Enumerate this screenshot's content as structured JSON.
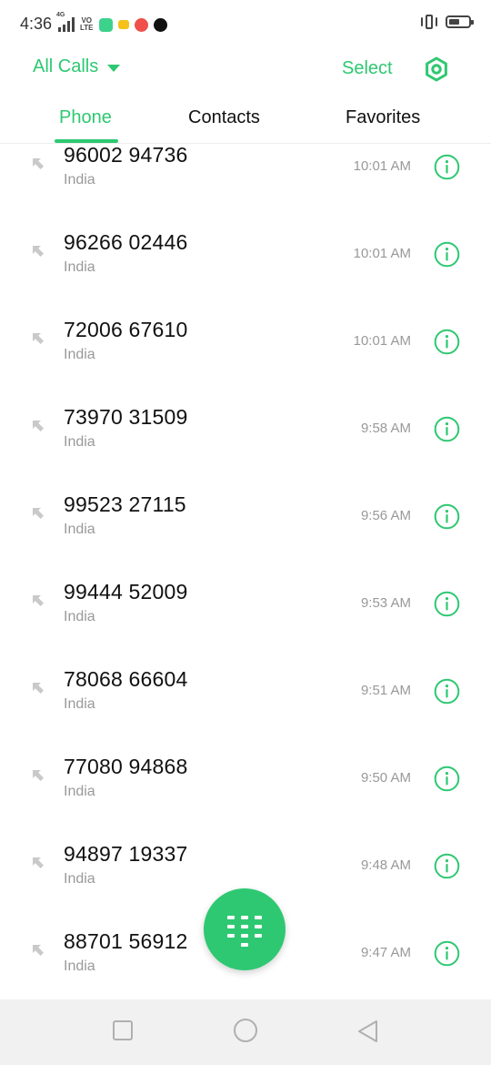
{
  "status_bar": {
    "time": "4:36",
    "network": "4G",
    "volte": "VO LTE",
    "battery_level": 0.55,
    "icons": [
      "signal-icon",
      "volte-icon",
      "app-icon-green",
      "app-icon-yellow",
      "app-icon-red",
      "app-icon-black",
      "vibrate-icon",
      "battery-icon"
    ]
  },
  "header": {
    "filter_label": "All Calls",
    "select_label": "Select",
    "settings_icon": "settings-icon"
  },
  "tabs": [
    {
      "label": "Phone",
      "active": true
    },
    {
      "label": "Contacts",
      "active": false
    },
    {
      "label": "Favorites",
      "active": false
    }
  ],
  "calls": [
    {
      "number": "96002 94736",
      "region": "India",
      "time": "10:01 AM",
      "type": "incoming"
    },
    {
      "number": "96266 02446",
      "region": "India",
      "time": "10:01 AM",
      "type": "incoming"
    },
    {
      "number": "72006 67610",
      "region": "India",
      "time": "10:01 AM",
      "type": "incoming"
    },
    {
      "number": "73970 31509",
      "region": "India",
      "time": "9:58 AM",
      "type": "incoming"
    },
    {
      "number": "99523 27115",
      "region": "India",
      "time": "9:56 AM",
      "type": "incoming"
    },
    {
      "number": "99444 52009",
      "region": "India",
      "time": "9:53 AM",
      "type": "incoming"
    },
    {
      "number": "78068 66604",
      "region": "India",
      "time": "9:51 AM",
      "type": "incoming"
    },
    {
      "number": "77080 94868",
      "region": "India",
      "time": "9:50 AM",
      "type": "incoming"
    },
    {
      "number": "94897 19337",
      "region": "India",
      "time": "9:48 AM",
      "type": "incoming"
    },
    {
      "number": "88701 56912",
      "region": "India",
      "time": "9:47 AM",
      "type": "incoming"
    }
  ],
  "colors": {
    "accent": "#2ec872",
    "text_primary": "#111111",
    "text_secondary": "#999999",
    "arrow": "#c9c9c9",
    "navbar": "#f1f1f1"
  },
  "nav": [
    "recents-icon",
    "home-icon",
    "back-icon"
  ]
}
